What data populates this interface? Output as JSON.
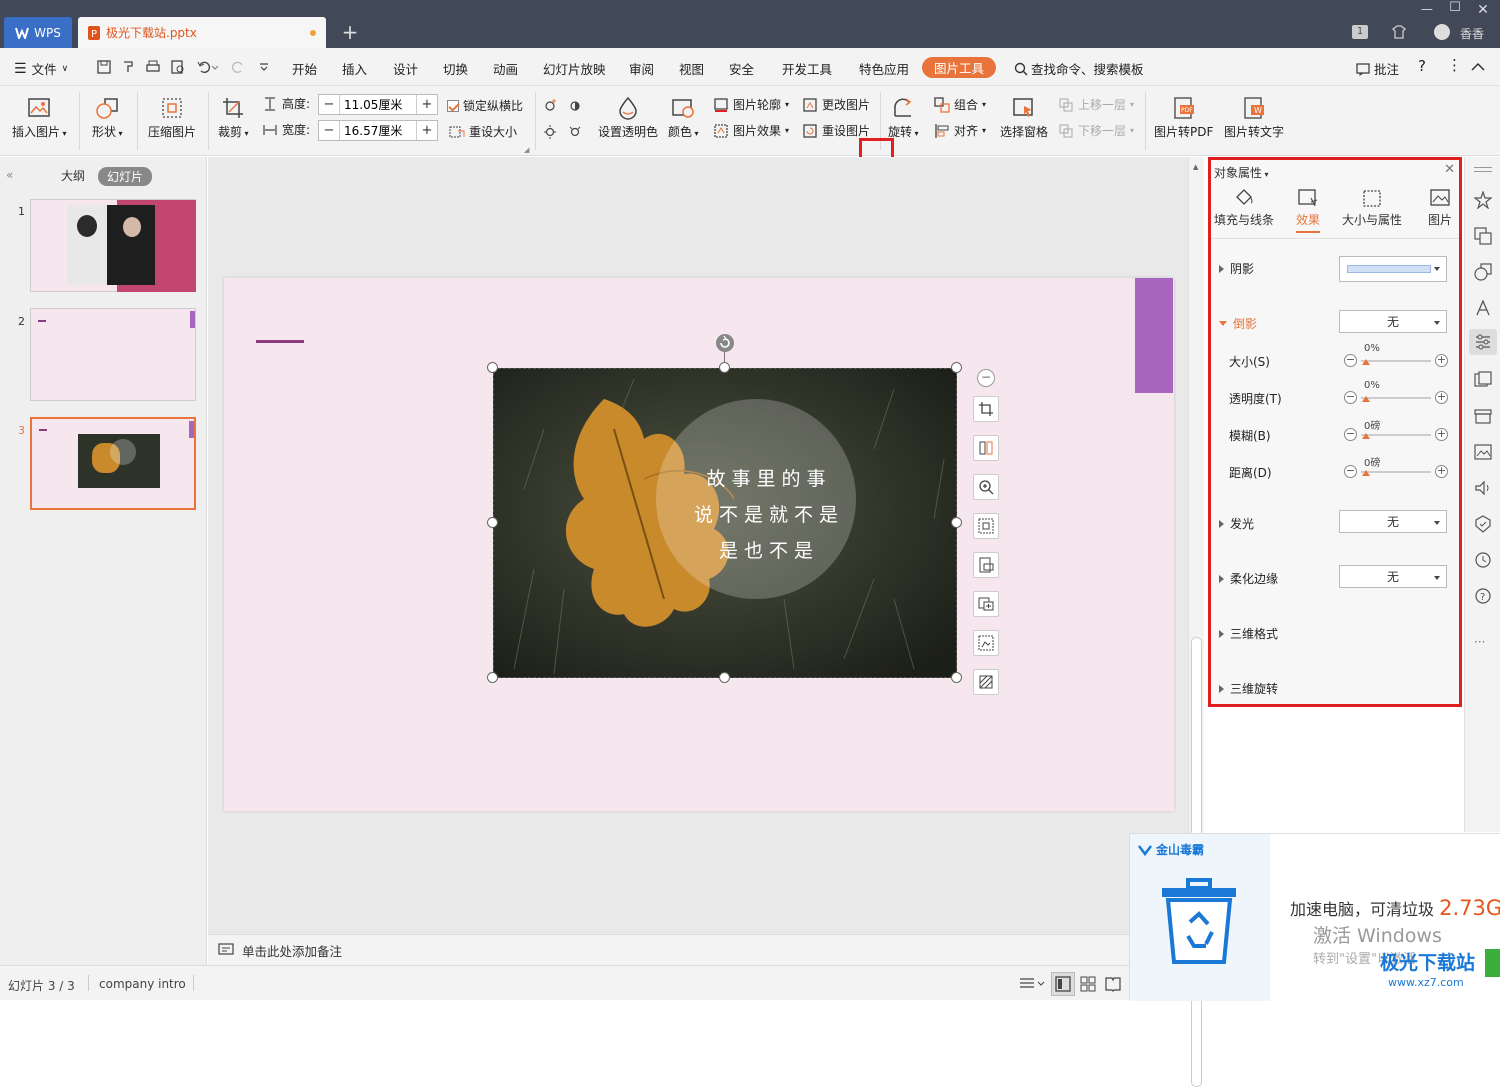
{
  "titlebar": {
    "app_tab": "WPS",
    "doc_tab": "极光下载站.pptx",
    "user": "香香",
    "badge": "1"
  },
  "menu": {
    "file": "文件",
    "items": [
      "开始",
      "插入",
      "设计",
      "切换",
      "动画",
      "幻灯片放映",
      "审阅",
      "视图",
      "安全",
      "开发工具",
      "特色应用"
    ],
    "active": "图片工具",
    "search": "查找命令、搜索模板",
    "comment": "批注"
  },
  "ribbon": {
    "insert_image": "插入图片",
    "shape": "形状",
    "compress": "压缩图片",
    "crop": "裁剪",
    "height_label": "高度:",
    "height_value": "11.05厘米",
    "width_label": "宽度:",
    "width_value": "16.57厘米",
    "lock_ratio": "锁定纵横比",
    "reset_size": "重设大小",
    "transparency": "设置透明色",
    "color": "颜色",
    "outline": "图片轮廓",
    "effects": "图片效果",
    "change_image": "更改图片",
    "reset_image": "重设图片",
    "rotate": "旋转",
    "group": "组合",
    "align": "对齐",
    "selection_pane": "选择窗格",
    "bring_forward": "上移一层",
    "send_backward": "下移一层",
    "to_pdf": "图片转PDF",
    "to_text": "图片转文字"
  },
  "left_panel": {
    "tab_outline": "大纲",
    "tab_slides": "幻灯片",
    "slides": [
      "1",
      "2",
      "3"
    ]
  },
  "slide": {
    "image_text": [
      "故事里的事",
      "说不是就不是",
      "是也不是"
    ]
  },
  "props": {
    "title": "对象属性",
    "tabs": [
      "填充与线条",
      "效果",
      "大小与属性",
      "图片"
    ],
    "active_tab": "效果",
    "shadow": "阴影",
    "reflection": "倒影",
    "reflection_value": "无",
    "size_label": "大小(S)",
    "size_value": "0%",
    "transparency_label": "透明度(T)",
    "transparency_value": "0%",
    "blur_label": "模糊(B)",
    "blur_value": "0磅",
    "distance_label": "距离(D)",
    "distance_value": "0磅",
    "glow": "发光",
    "glow_value": "无",
    "soft_edges": "柔化边缘",
    "soft_edges_value": "无",
    "format_3d": "三维格式",
    "rotation_3d": "三维旋转"
  },
  "notes": {
    "placeholder": "单击此处添加备注"
  },
  "status": {
    "slide_count": "幻灯片 3 / 3",
    "theme": "company intro"
  },
  "popup": {
    "brand": "金山毒霸",
    "message": "加速电脑，可清垃圾",
    "amount": "2.73G",
    "activate_title": "激活 Windows",
    "activate_sub": "转到\"设置\"以激活",
    "watermark": "极光下载站",
    "watermark_url": "www.xz7.com"
  },
  "colors": {
    "accent": "#e8743b",
    "highlight_box": "#e02020",
    "titlebar": "#414858",
    "slide_bg": "#f6e6ee",
    "slide_accent": "#a866c0"
  }
}
